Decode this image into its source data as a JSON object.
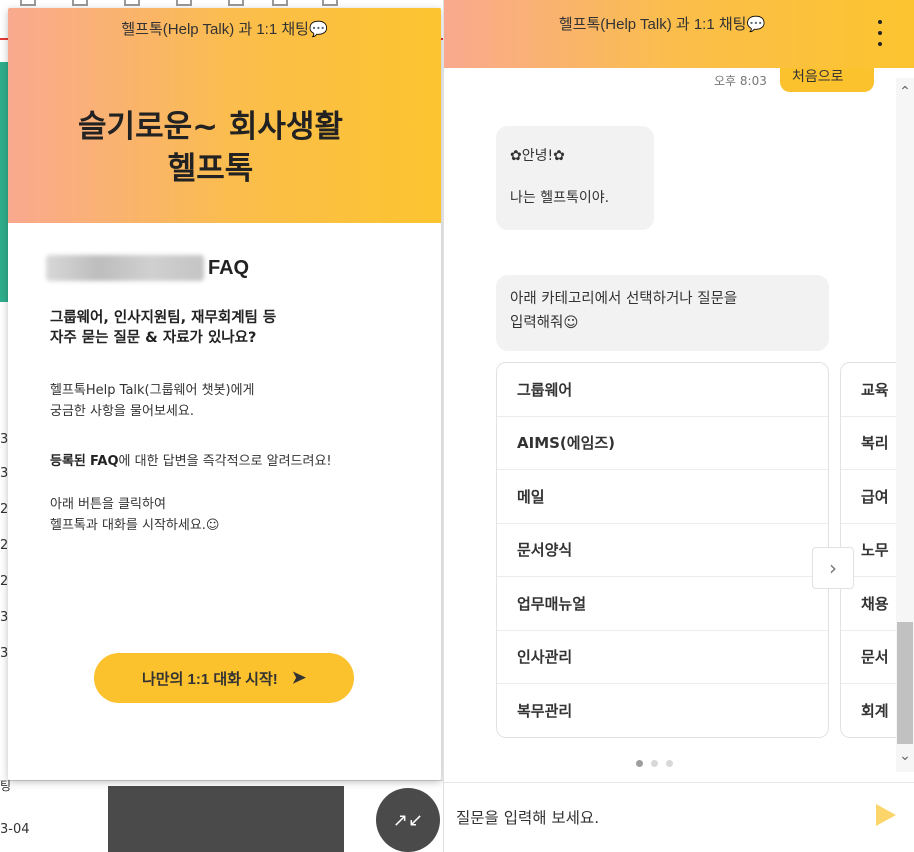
{
  "left_card": {
    "header_title": "헬프톡(Help Talk) 과 1:1 채팅💬",
    "hero_line1": "슬기로운~ 회사생활",
    "hero_line2": "헬프톡",
    "faq_title": "FAQ",
    "question_line1": "그룹웨어, 인사지원팀, 재무회계팀 등",
    "question_line2": "자주 묻는 질문 & 자료가 있나요?",
    "para1_line1": "헬프톡Help Talk(그룹웨어 챗봇)에게",
    "para1_line2": "궁금한 사항을 물어보세요.",
    "para2_bold1": "등록된",
    "para2_bold2": "FAQ",
    "para2_rest": "에 대한 답변을 즉각적으로 알려드려요!",
    "para3_line1": "아래 버튼을 클릭하여",
    "para3_line2": "헬프톡과 대화를 시작하세요.☺",
    "start_button": "나만의 1:1 대화 시작!",
    "start_arrow": "➤"
  },
  "minimize_button": {
    "icon": "minimize-arrows-icon",
    "glyph": "↗↙"
  },
  "chat": {
    "header_title": "헬프톡(Help Talk) 과 1:1 채팅💬",
    "user_message_partial": "처음으로",
    "user_message_time": "오후 8:03",
    "bot_greeting_line1": "✿안녕!✿",
    "bot_greeting_line2": "나는 헬프톡이야.",
    "bot_prompt_line1": "아래 카테고리에서 선택하거나 질문을",
    "bot_prompt_line2": "입력해줘☺",
    "categories": [
      "그룹웨어",
      "AIMS(에임즈)",
      "메일",
      "문서양식",
      "업무매뉴얼",
      "인사관리",
      "복무관리"
    ],
    "categories_next": [
      "교육",
      "복리",
      "급여",
      "노무",
      "채용",
      "문서",
      "회계"
    ],
    "input_placeholder": "질문을 입력해 보세요."
  },
  "background": {
    "row_numbers": [
      "3",
      "3",
      "2",
      "2",
      "2",
      "3",
      "3"
    ],
    "bottom_label": "팅",
    "date": "3-04"
  },
  "colors": {
    "accent_yellow": "#fcc22d",
    "gradient_start": "#f9a98f",
    "gradient_end": "#fcc42f",
    "dark_button": "#4a4a4a"
  }
}
